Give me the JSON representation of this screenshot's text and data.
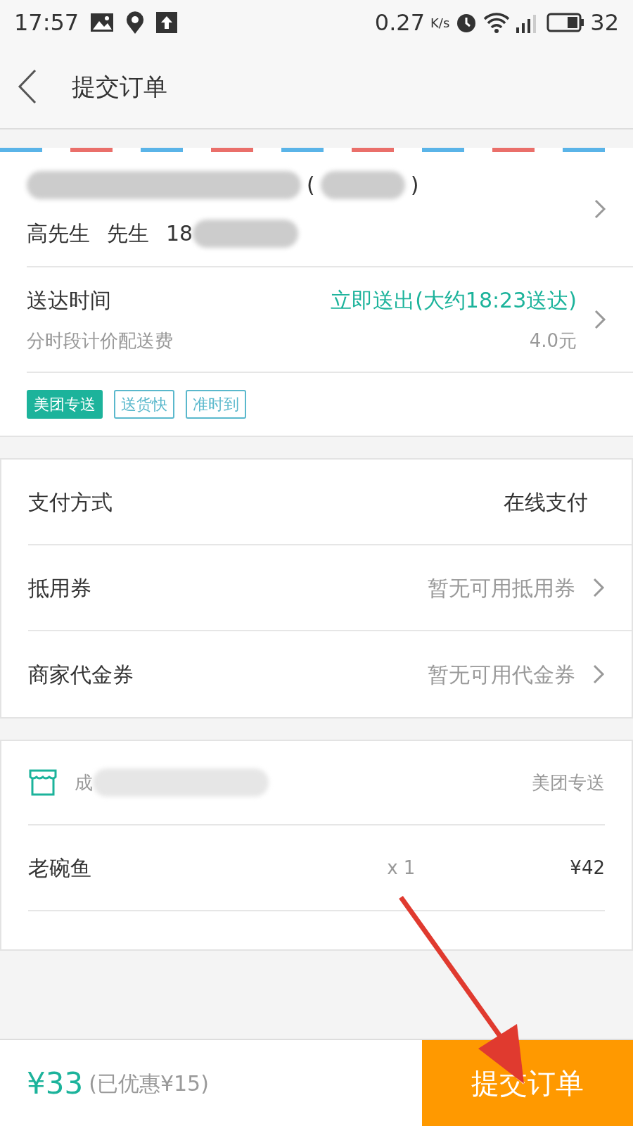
{
  "status_bar": {
    "time": "17:57",
    "speed": "0.27",
    "speed_unit": "K/s",
    "battery": "32"
  },
  "header": {
    "title": "提交订单"
  },
  "address": {
    "name": "高先生",
    "salutation": "先生",
    "phone": "18",
    "open_paren": "(",
    "close_paren": ")"
  },
  "delivery": {
    "label": "送达时间",
    "value": "立即送出(大约18:23送达)",
    "note": "分时段计价配送费",
    "fee": "4.0元"
  },
  "tags": [
    {
      "label": "美团专送",
      "kind": "solid"
    },
    {
      "label": "送货快",
      "kind": "outline"
    },
    {
      "label": "准时到",
      "kind": "outline"
    }
  ],
  "payment_rows": [
    {
      "label": "支付方式",
      "value": "在线支付",
      "kind": "plain"
    },
    {
      "label": "抵用券",
      "value": "暂无可用抵用券",
      "kind": "link"
    },
    {
      "label": "商家代金券",
      "value": "暂无可用代金券",
      "kind": "link"
    }
  ],
  "store": {
    "name": "成",
    "delivery": "美团专送"
  },
  "items": [
    {
      "name": "老碗鱼",
      "qty": "x 1",
      "price": "¥42"
    }
  ],
  "footer": {
    "total": "¥33",
    "discount": "(已优惠¥15)",
    "submit": "提交订单"
  }
}
